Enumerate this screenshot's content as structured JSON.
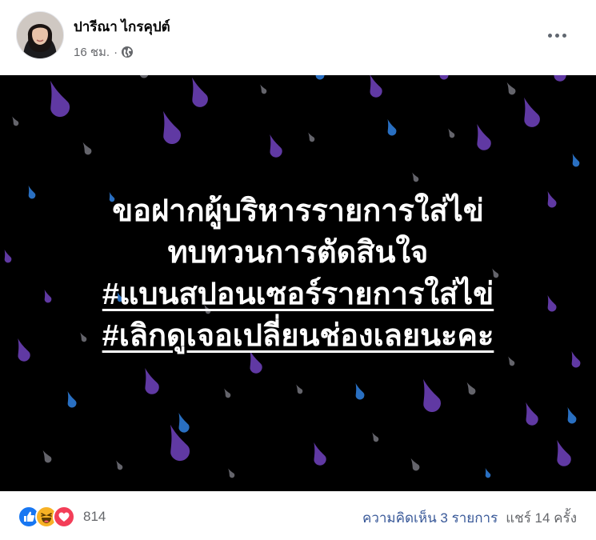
{
  "post": {
    "author_name": "ปารีณา ไกรคุปต์",
    "timestamp": "16 ชม.",
    "separator": "·",
    "privacy_icon": "globe-icon",
    "more_icon": "more-options-icon"
  },
  "image_text": {
    "line1": "ขอฝากผู้บริหารรายการใส่ไข่",
    "line2": "ทบทวนการตัดสินใจ",
    "hashtag1": "#แบนสปอนเซอร์รายการใส่ไข่",
    "hashtag2": "#เลิกดูเจอเปลี่ยนช่องเลยนะคะ"
  },
  "footer": {
    "reaction_icons": [
      "like-icon",
      "haha-icon",
      "love-icon"
    ],
    "reaction_count": "814",
    "comments": "ความคิดเห็น 3 รายการ",
    "shares": "แชร์ 14 ครั้ง"
  },
  "colors": {
    "background": "#000000",
    "drop_purple": "#6a3fb5",
    "drop_blue": "#2e7bd6",
    "drop_gray": "#7d7d86",
    "like_blue": "#1877f2",
    "love_red": "#f33e58",
    "haha_yellow": "#f7b125",
    "link_blue": "#385898"
  }
}
